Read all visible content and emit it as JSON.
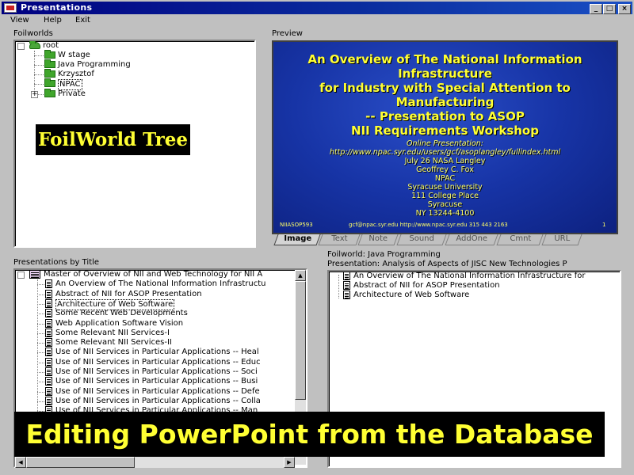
{
  "window": {
    "title": "Presentations"
  },
  "menu": [
    "View",
    "Help",
    "Exit"
  ],
  "foilworlds": {
    "label": "Foilworlds",
    "items": [
      {
        "label": "root"
      },
      {
        "label": "W stage"
      },
      {
        "label": "Java Programming"
      },
      {
        "label": "Krzysztof"
      },
      {
        "label": "NPAC"
      },
      {
        "label": "Private"
      }
    ],
    "overlay": "FoilWorld Tree"
  },
  "preview": {
    "label": "Preview",
    "slide": {
      "title_lines": [
        "An Overview of The National Information",
        "Infrastructure",
        "for Industry with Special Attention to",
        "Manufacturing",
        "-- Presentation to ASOP",
        "NII Requirements Workshop"
      ],
      "body_lines": [
        "Online Presentation:",
        "http://www.npac.syr.edu/users/gcf/asoplangley/fullindex.html",
        "July 26 NASA Langley",
        "Geoffrey C. Fox",
        "NPAC",
        "Syracuse University",
        "111 College Place",
        "Syracuse",
        "NY 13244-4100"
      ],
      "footer_left": "NIIASOP593",
      "footer_mid": "gcf@npac.syr.edu  http://www.npac.syr.edu  315 443 2163",
      "footer_page": "1"
    },
    "tabs": [
      "Image",
      "Text",
      "Note",
      "Sound",
      "AddOne",
      "Cmnt",
      "URL"
    ]
  },
  "presentations": {
    "label": "Presentations by Title",
    "items": [
      "Master of Overview of NII and Web Technology for NII A",
      "An Overview of The National Information Infrastructu",
      "Abstract of NII for ASOP Presentation",
      "Architecture of Web Software",
      "Some Recent Web Developments",
      "Web Application Software Vision",
      "Some Relevant NII Services-I",
      "Some Relevant NII Services-II",
      "Use of NII Services in Particular Applications -- Heal",
      "Use of NII Services in Particular Applications -- Educ",
      "Use of NII Services in Particular Applications -- Soci",
      "Use of NII Services in Particular Applications -- Busi",
      "Use of NII Services in Particular Applications -- Defe",
      "Use of NII Services in Particular Applications -- Colla",
      "Use of NII Services in Particular Applications -- Man"
    ]
  },
  "foilworld_panel": {
    "foilworld_label": "Foilworld: Java Programming",
    "presentation_label": "Presentation: Analysis of Aspects of JISC New Technologies P",
    "items": [
      "An Overview of The National Information Infrastructure for",
      "Abstract of NII for ASOP Presentation",
      "Architecture of Web Software"
    ]
  },
  "banner": "Editing PowerPoint from the Database"
}
